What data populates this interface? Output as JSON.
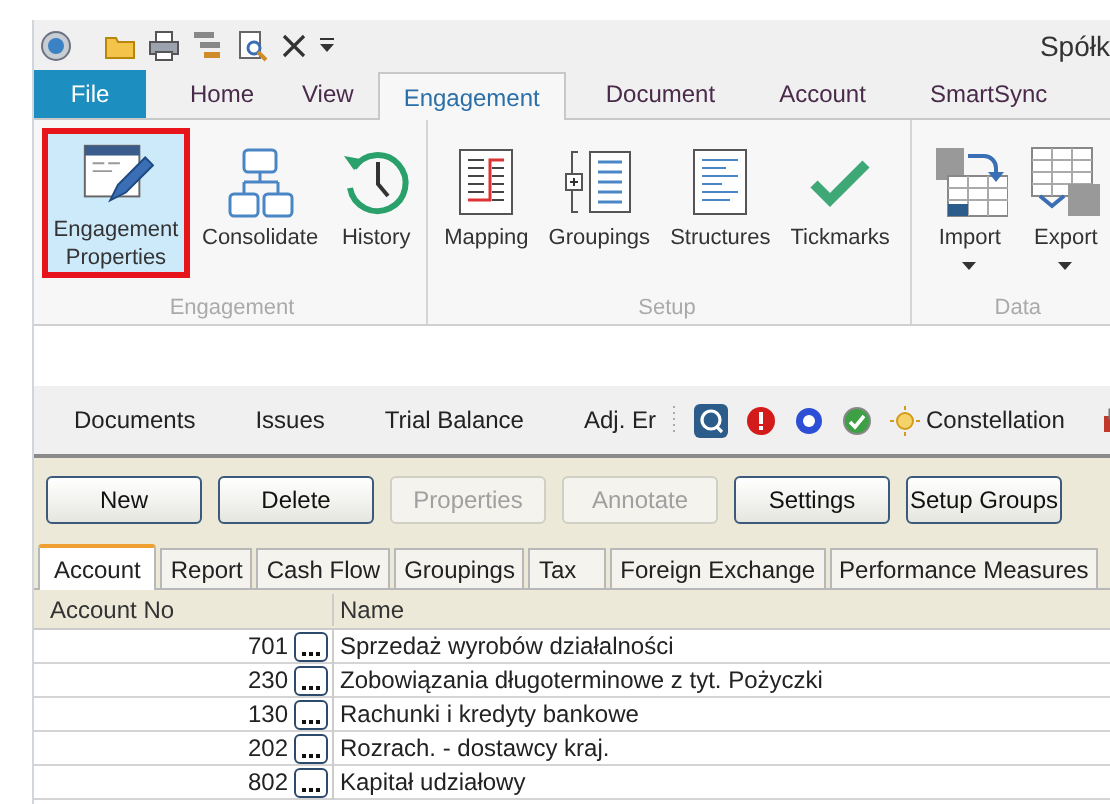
{
  "window": {
    "title": "Spółk"
  },
  "ribbon_tabs": [
    {
      "label": "File",
      "kind": "file"
    },
    {
      "label": "Home",
      "kind": "tab",
      "selected": false
    },
    {
      "label": "View",
      "kind": "tab",
      "selected": false
    },
    {
      "label": "Engagement",
      "kind": "tab",
      "selected": true
    },
    {
      "label": "Document",
      "kind": "tab",
      "selected": false
    },
    {
      "label": "Account",
      "kind": "tab",
      "selected": false
    },
    {
      "label": "SmartSync",
      "kind": "tab",
      "selected": false
    }
  ],
  "ribbon_groups": [
    {
      "label": "Engagement",
      "buttons": [
        {
          "label": "Engagement Properties",
          "kind": "properties",
          "highlighted": true,
          "dropdown": false
        },
        {
          "label": "Consolidate",
          "kind": "consolidate",
          "highlighted": false,
          "dropdown": false
        },
        {
          "label": "History",
          "kind": "history",
          "highlighted": false,
          "dropdown": false
        }
      ]
    },
    {
      "label": "Setup",
      "buttons": [
        {
          "label": "Mapping",
          "kind": "mapping",
          "highlighted": false,
          "dropdown": false
        },
        {
          "label": "Groupings",
          "kind": "groupings",
          "highlighted": false,
          "dropdown": false
        },
        {
          "label": "Structures",
          "kind": "structures",
          "highlighted": false,
          "dropdown": false
        },
        {
          "label": "Tickmarks",
          "kind": "tickmarks",
          "highlighted": false,
          "dropdown": false
        }
      ]
    },
    {
      "label": "Data",
      "buttons": [
        {
          "label": "Import",
          "kind": "import",
          "highlighted": false,
          "dropdown": true
        },
        {
          "label": "Export",
          "kind": "export",
          "highlighted": false,
          "dropdown": true
        }
      ]
    }
  ],
  "nav_bar": {
    "items": [
      "Documents",
      "Issues",
      "Trial Balance",
      "Adj. Er"
    ],
    "constellation": "Constellation"
  },
  "toolbar_buttons": [
    {
      "label": "New",
      "disabled": false
    },
    {
      "label": "Delete",
      "disabled": false
    },
    {
      "label": "Properties",
      "disabled": true
    },
    {
      "label": "Annotate",
      "disabled": true
    },
    {
      "label": "Settings",
      "disabled": false
    },
    {
      "label": "Setup Groups",
      "disabled": false
    }
  ],
  "tabs": [
    {
      "label": "Account",
      "selected": true
    },
    {
      "label": "Report",
      "selected": false
    },
    {
      "label": "Cash Flow",
      "selected": false
    },
    {
      "label": "Groupings",
      "selected": false
    },
    {
      "label": "Tax",
      "selected": false
    },
    {
      "label": "Foreign Exchange",
      "selected": false
    },
    {
      "label": "Performance Measures",
      "selected": false
    }
  ],
  "table": {
    "columns": [
      "Account No",
      "Name"
    ],
    "rows": [
      {
        "account_no": "701",
        "name": "Sprzedaż wyrobów działalności"
      },
      {
        "account_no": "230",
        "name": "Zobowiązania długoterminowe z tyt. Pożyczki"
      },
      {
        "account_no": "130",
        "name": "Rachunki i kredyty bankowe"
      },
      {
        "account_no": "202",
        "name": "Rozrach. - dostawcy kraj."
      },
      {
        "account_no": "802",
        "name": "Kapitał udziałowy"
      }
    ]
  }
}
